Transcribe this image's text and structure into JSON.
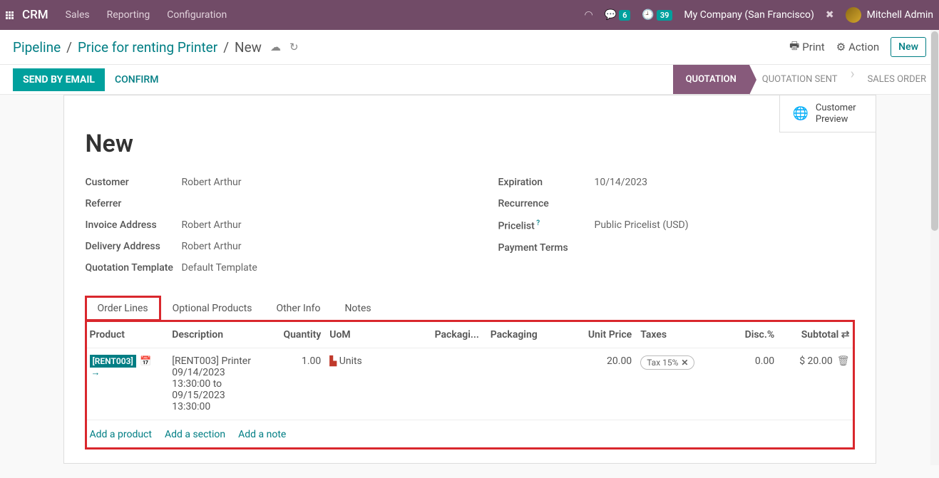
{
  "navbar": {
    "brand": "CRM",
    "menu": [
      "Sales",
      "Reporting",
      "Configuration"
    ],
    "chat_badge": "6",
    "clock_badge": "39",
    "company": "My Company (San Francisco)",
    "user": "Mitchell Admin"
  },
  "breadcrumb": {
    "path": [
      "Pipeline",
      "Price for renting Printer",
      "New"
    ]
  },
  "top_actions": {
    "print": "Print",
    "action": "Action",
    "new": "New"
  },
  "status_buttons": {
    "send": "SEND BY EMAIL",
    "confirm": "CONFIRM"
  },
  "stages": [
    "QUOTATION",
    "QUOTATION SENT",
    "SALES ORDER"
  ],
  "preview": {
    "label": "Customer\nPreview"
  },
  "record_title": "New",
  "fields_left": {
    "customer_label": "Customer",
    "customer": "Robert Arthur",
    "referrer_label": "Referrer",
    "referrer": "",
    "invoice_label": "Invoice Address",
    "invoice": "Robert Arthur",
    "delivery_label": "Delivery Address",
    "delivery": "Robert Arthur",
    "qtpl_label": "Quotation Template",
    "qtpl": "Default Template"
  },
  "fields_right": {
    "exp_label": "Expiration",
    "exp": "10/14/2023",
    "rec_label": "Recurrence",
    "rec": "",
    "price_label": "Pricelist",
    "price": "Public Pricelist (USD)",
    "pay_label": "Payment Terms",
    "pay": ""
  },
  "tabs": [
    "Order Lines",
    "Optional Products",
    "Other Info",
    "Notes"
  ],
  "table": {
    "headers": {
      "product": "Product",
      "description": "Description",
      "quantity": "Quantity",
      "uom": "UoM",
      "packagi": "Packagi...",
      "packaging": "Packaging",
      "unit_price": "Unit Price",
      "taxes": "Taxes",
      "disc": "Disc.%",
      "subtotal": "Subtotal"
    },
    "row": {
      "product_code": "[RENT003]",
      "description": "[RENT003] Printer\n09/14/2023\n13:30:00 to\n09/15/2023\n13:30:00",
      "quantity": "1.00",
      "uom": "Units",
      "unit_price": "20.00",
      "tax": "Tax 15%",
      "disc": "0.00",
      "subtotal": "$ 20.00"
    },
    "links": {
      "product": "Add a product",
      "section": "Add a section",
      "note": "Add a note"
    }
  }
}
